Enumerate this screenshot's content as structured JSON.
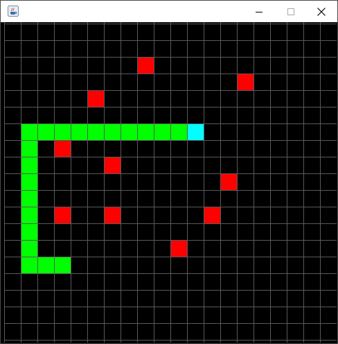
{
  "window": {
    "title": "",
    "controls": [
      "minimize",
      "maximize",
      "close"
    ],
    "icon": "java-coffee-cup-icon"
  },
  "game": {
    "grid": {
      "columns": 20,
      "rows": 19,
      "line_color": "#5a5a5a",
      "background": "#000000"
    },
    "snake": {
      "body_color": "#00ff00",
      "head_color": "#00ffff",
      "head": [
        11,
        6
      ],
      "body": [
        [
          10,
          6
        ],
        [
          9,
          6
        ],
        [
          8,
          6
        ],
        [
          7,
          6
        ],
        [
          6,
          6
        ],
        [
          5,
          6
        ],
        [
          4,
          6
        ],
        [
          3,
          6
        ],
        [
          2,
          6
        ],
        [
          1,
          6
        ],
        [
          1,
          7
        ],
        [
          1,
          8
        ],
        [
          1,
          9
        ],
        [
          1,
          10
        ],
        [
          1,
          11
        ],
        [
          1,
          12
        ],
        [
          1,
          13
        ],
        [
          1,
          14
        ],
        [
          2,
          14
        ],
        [
          3,
          14
        ]
      ]
    },
    "food": {
      "color": "#ff0000",
      "cells": [
        [
          8,
          2
        ],
        [
          14,
          3
        ],
        [
          5,
          4
        ],
        [
          3,
          7
        ],
        [
          6,
          8
        ],
        [
          13,
          9
        ],
        [
          3,
          11
        ],
        [
          6,
          11
        ],
        [
          12,
          11
        ],
        [
          10,
          13
        ]
      ]
    }
  }
}
